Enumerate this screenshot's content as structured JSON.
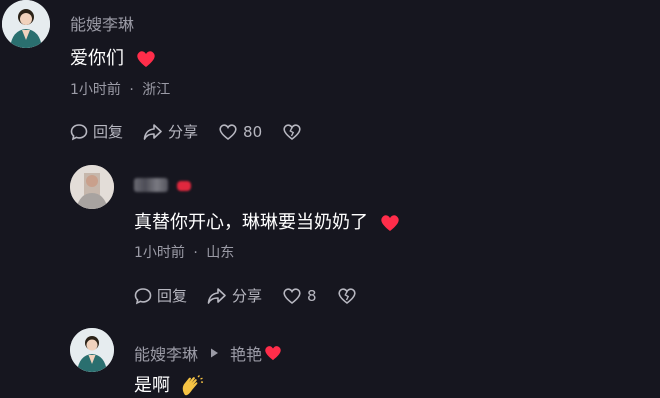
{
  "comments": [
    {
      "author": "能嫂李琳",
      "text": "爱你们",
      "time": "1小时前",
      "location": "浙江",
      "actions": {
        "reply": "回复",
        "share": "分享",
        "likes": "80"
      }
    },
    {
      "author": "",
      "text": "真替你开心，琳琳要当奶奶了",
      "time": "1小时前",
      "location": "山东",
      "actions": {
        "reply": "回复",
        "share": "分享",
        "likes": "8"
      }
    },
    {
      "author": "能嫂李琳",
      "reply_to": "艳艳",
      "text": "是啊"
    }
  ],
  "meta_separator": "·",
  "colors": {
    "heart": "#ff2d4a",
    "muted": "#9b9ba6",
    "background": "#16161f"
  },
  "icons": [
    "comment-icon",
    "share-icon",
    "like-icon",
    "dislike-icon",
    "heart-emoji",
    "clap-emoji",
    "play-arrow-icon"
  ]
}
